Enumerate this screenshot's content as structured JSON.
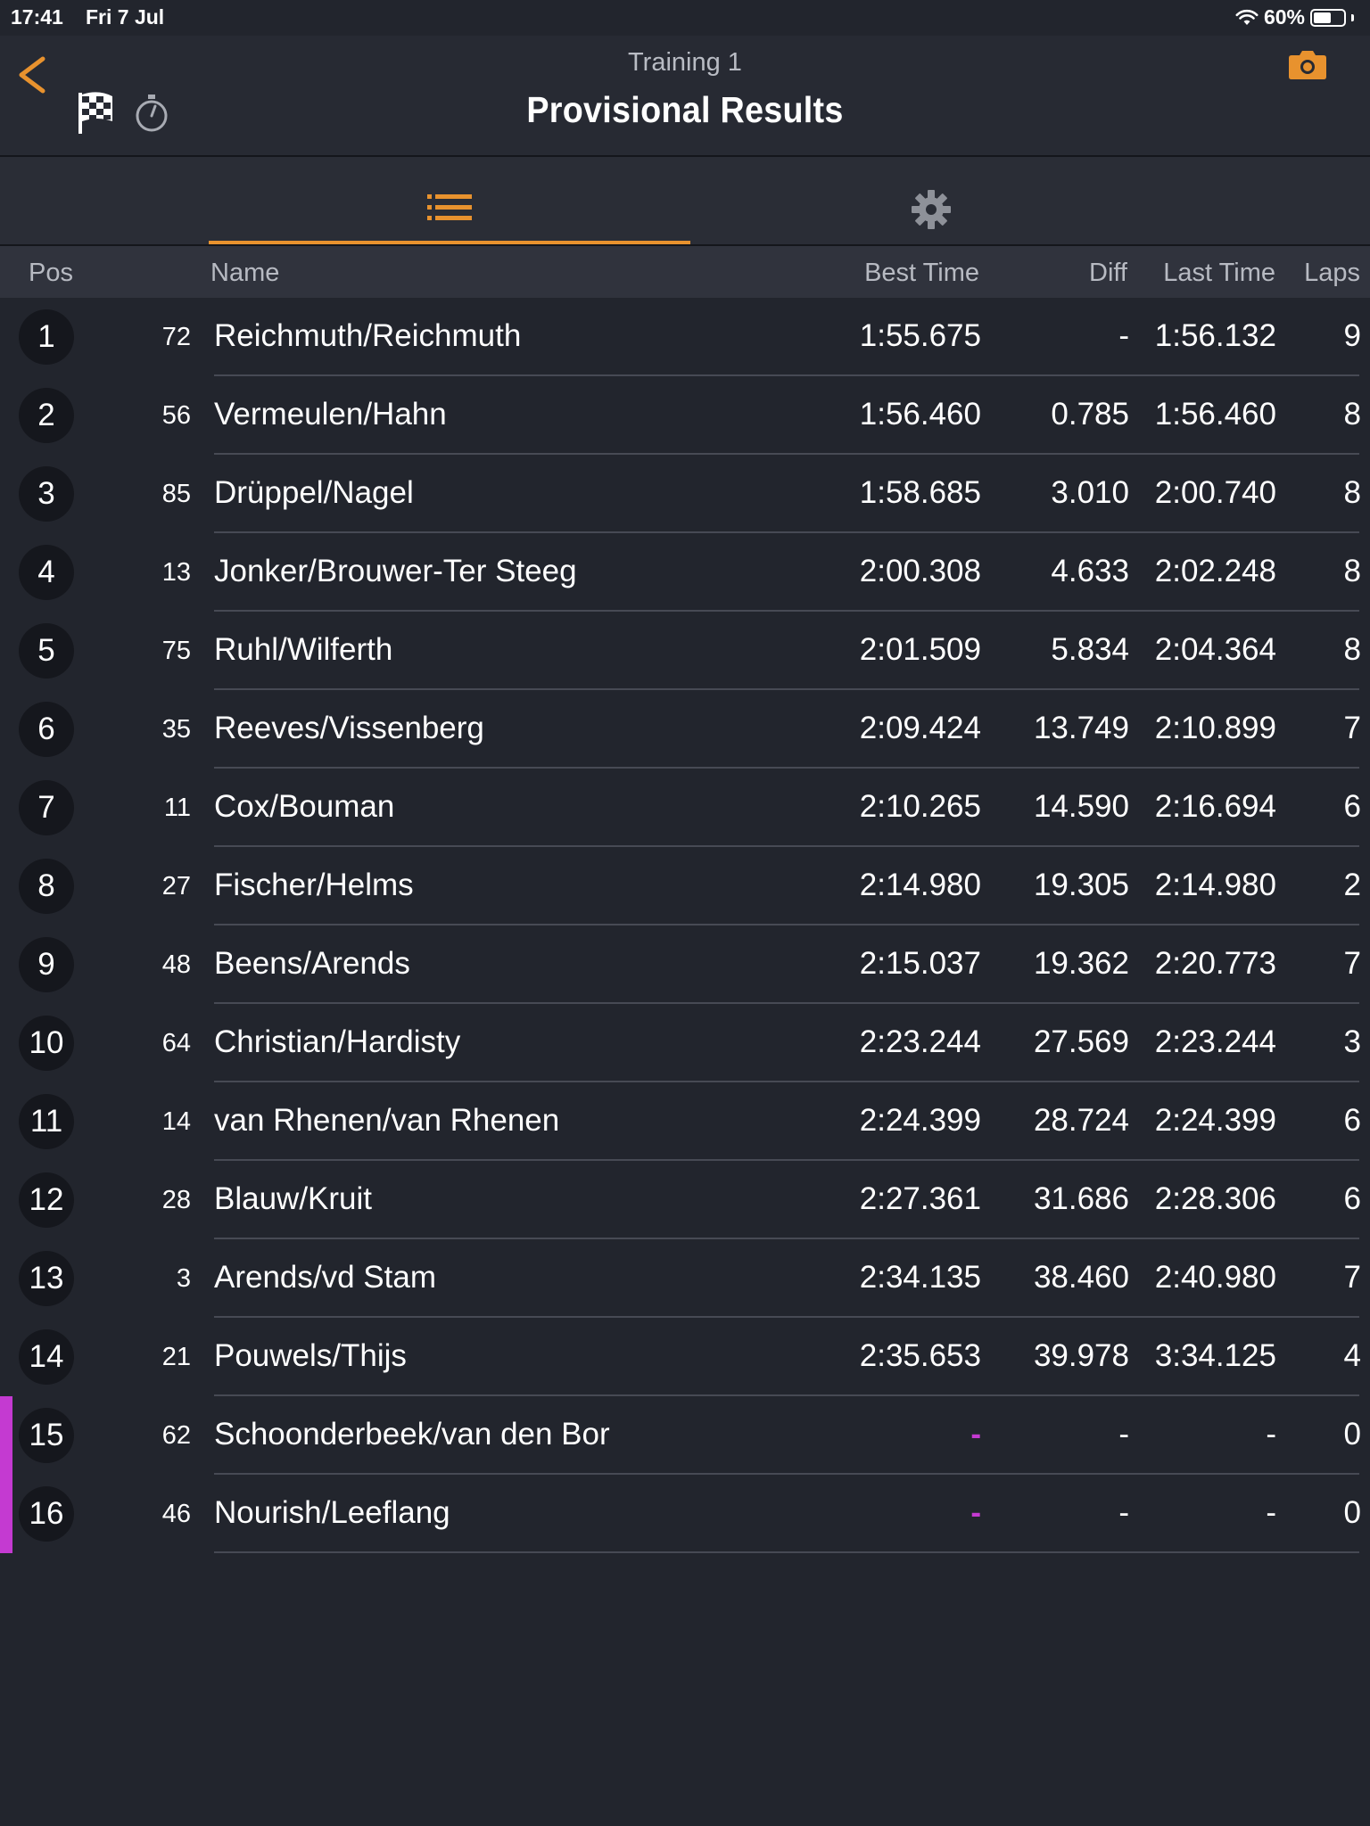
{
  "status_bar": {
    "time": "17:41",
    "date": "Fri 7 Jul",
    "battery_percent": "60%",
    "battery_level": 0.6
  },
  "header": {
    "subtitle": "Training 1",
    "title": "Provisional Results",
    "accent_color": "#e8922e"
  },
  "tabs": [
    {
      "name": "results-list",
      "icon": "list-icon",
      "selected": true
    },
    {
      "name": "settings",
      "icon": "gear-icon",
      "selected": false
    }
  ],
  "columns": {
    "pos": "Pos",
    "name": "Name",
    "best_time": "Best Time",
    "diff": "Diff",
    "last_time": "Last Time",
    "laps": "Laps"
  },
  "rows": [
    {
      "pos": "1",
      "number": "72",
      "name": "Reichmuth/Reichmuth",
      "best": "1:55.675",
      "diff": "-",
      "last": "1:56.132",
      "laps": "9",
      "flag": false
    },
    {
      "pos": "2",
      "number": "56",
      "name": "Vermeulen/Hahn",
      "best": "1:56.460",
      "diff": "0.785",
      "last": "1:56.460",
      "laps": "8",
      "flag": false
    },
    {
      "pos": "3",
      "number": "85",
      "name": "Drüppel/Nagel",
      "best": "1:58.685",
      "diff": "3.010",
      "last": "2:00.740",
      "laps": "8",
      "flag": false
    },
    {
      "pos": "4",
      "number": "13",
      "name": "Jonker/Brouwer-Ter Steeg",
      "best": "2:00.308",
      "diff": "4.633",
      "last": "2:02.248",
      "laps": "8",
      "flag": false
    },
    {
      "pos": "5",
      "number": "75",
      "name": "Ruhl/Wilferth",
      "best": "2:01.509",
      "diff": "5.834",
      "last": "2:04.364",
      "laps": "8",
      "flag": false
    },
    {
      "pos": "6",
      "number": "35",
      "name": "Reeves/Vissenberg",
      "best": "2:09.424",
      "diff": "13.749",
      "last": "2:10.899",
      "laps": "7",
      "flag": false
    },
    {
      "pos": "7",
      "number": "11",
      "name": "Cox/Bouman",
      "best": "2:10.265",
      "diff": "14.590",
      "last": "2:16.694",
      "laps": "6",
      "flag": false
    },
    {
      "pos": "8",
      "number": "27",
      "name": "Fischer/Helms",
      "best": "2:14.980",
      "diff": "19.305",
      "last": "2:14.980",
      "laps": "2",
      "flag": false
    },
    {
      "pos": "9",
      "number": "48",
      "name": "Beens/Arends",
      "best": "2:15.037",
      "diff": "19.362",
      "last": "2:20.773",
      "laps": "7",
      "flag": false
    },
    {
      "pos": "10",
      "number": "64",
      "name": "Christian/Hardisty",
      "best": "2:23.244",
      "diff": "27.569",
      "last": "2:23.244",
      "laps": "3",
      "flag": false
    },
    {
      "pos": "11",
      "number": "14",
      "name": "van Rhenen/van Rhenen",
      "best": "2:24.399",
      "diff": "28.724",
      "last": "2:24.399",
      "laps": "6",
      "flag": false
    },
    {
      "pos": "12",
      "number": "28",
      "name": "Blauw/Kruit",
      "best": "2:27.361",
      "diff": "31.686",
      "last": "2:28.306",
      "laps": "6",
      "flag": false
    },
    {
      "pos": "13",
      "number": "3",
      "name": "Arends/vd Stam",
      "best": "2:34.135",
      "diff": "38.460",
      "last": "2:40.980",
      "laps": "7",
      "flag": false
    },
    {
      "pos": "14",
      "number": "21",
      "name": "Pouwels/Thijs",
      "best": "2:35.653",
      "diff": "39.978",
      "last": "3:34.125",
      "laps": "4",
      "flag": false
    },
    {
      "pos": "15",
      "number": "62",
      "name": "Schoonderbeek/van den Bor",
      "best": "-",
      "diff": "-",
      "last": "-",
      "laps": "0",
      "flag": true
    },
    {
      "pos": "16",
      "number": "46",
      "name": "Nourish/Leeflang",
      "best": "-",
      "diff": "-",
      "last": "-",
      "laps": "0",
      "flag": true
    }
  ],
  "colors": {
    "background": "#22252d",
    "highlight_purple": "#c43ad1"
  }
}
